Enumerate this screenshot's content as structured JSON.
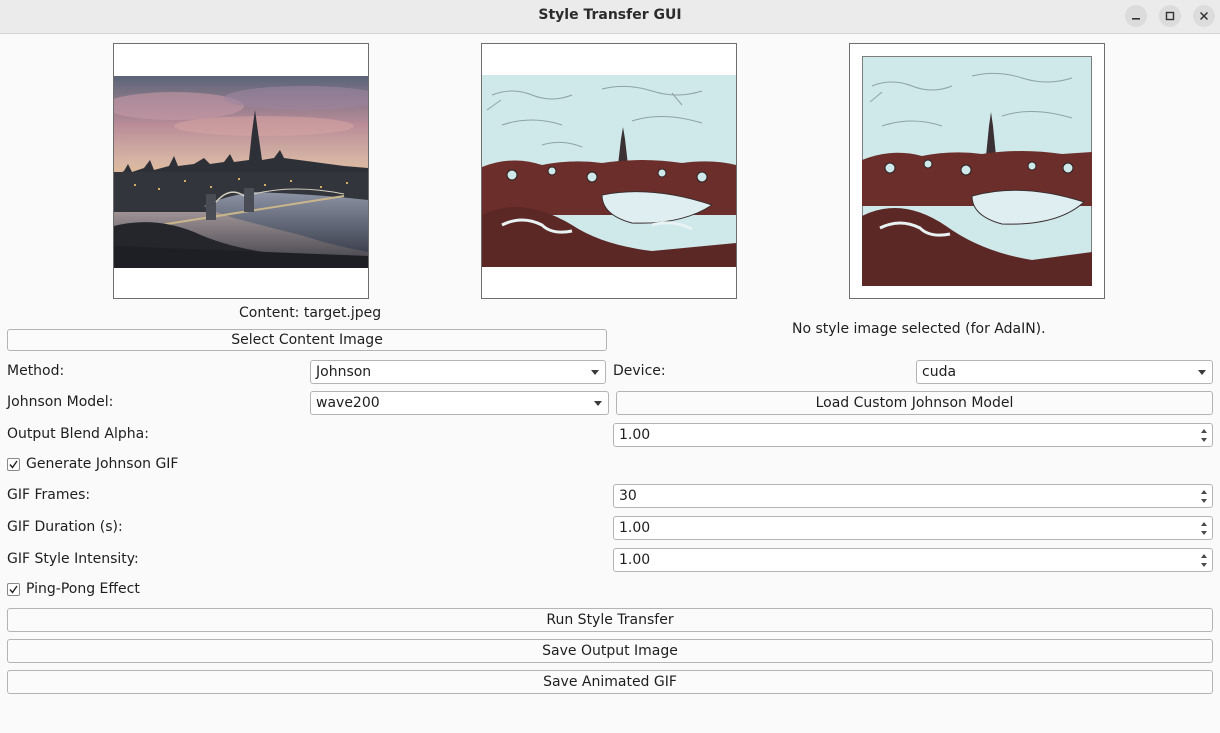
{
  "window": {
    "title": "Style Transfer GUI",
    "controls": [
      "minimize-icon",
      "maximize-icon",
      "close-icon"
    ]
  },
  "images": {
    "content_caption": "Content: target.jpeg",
    "style_caption": "No style image selected (for AdaIN)."
  },
  "buttons": {
    "select_content": "Select Content Image",
    "load_custom": "Load Custom Johnson Model",
    "run": "Run Style Transfer",
    "save_output": "Save Output Image",
    "save_gif": "Save Animated GIF"
  },
  "form": {
    "method_label": "Method:",
    "method_value": "Johnson",
    "device_label": "Device:",
    "device_value": "cuda",
    "model_label": "Johnson Model:",
    "model_value": "wave200",
    "alpha_label": "Output Blend Alpha:",
    "alpha_value": "1.00",
    "gen_gif_label": "Generate Johnson GIF",
    "gen_gif_checked": true,
    "frames_label": "GIF Frames:",
    "frames_value": "30",
    "duration_label": "GIF Duration (s):",
    "duration_value": "1.00",
    "intensity_label": "GIF Style Intensity:",
    "intensity_value": "1.00",
    "pingpong_label": "Ping-Pong Effect",
    "pingpong_checked": true
  },
  "colors": {
    "window_bg": "#fafafa",
    "titlebar_bg": "#ebebeb",
    "stylized_ice": "#cfe8ea",
    "stylized_maroon": "#6b2e2a"
  }
}
